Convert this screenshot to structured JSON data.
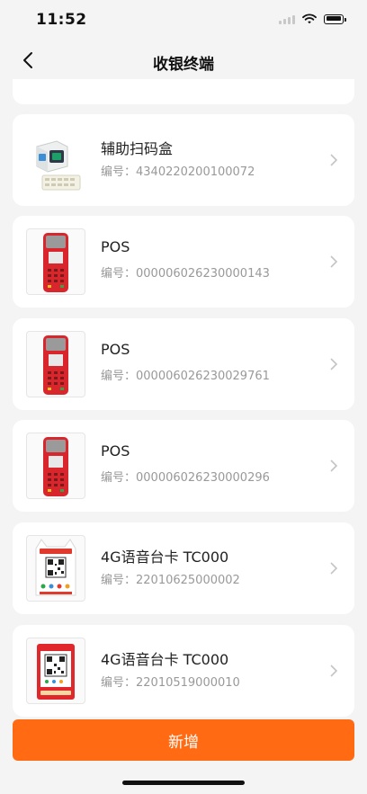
{
  "status_bar": {
    "time": "11:52"
  },
  "nav": {
    "title": "收银终端",
    "back_icon": "chevron-left-icon"
  },
  "device_list": [
    {
      "name": "",
      "sn_label": "",
      "sn": "",
      "image": "scanner-box-icon"
    },
    {
      "name": "辅助扫码盒",
      "sn_label": "编号：",
      "sn": "4340220200100072",
      "image": "scanner-box-icon"
    },
    {
      "name": "POS",
      "sn_label": "编号：",
      "sn": "000006026230000143",
      "image": "pos-terminal-icon"
    },
    {
      "name": "POS",
      "sn_label": "编号：",
      "sn": "000006026230029761",
      "image": "pos-terminal-icon"
    },
    {
      "name": "POS",
      "sn_label": "编号：",
      "sn": "000006026230000296",
      "image": "pos-terminal-icon"
    },
    {
      "name": "4G语音台卡 TC000",
      "sn_label": "编号：",
      "sn": "22010625000002",
      "image": "qr-standee-cat-icon"
    },
    {
      "name": "4G语音台卡 TC000",
      "sn_label": "编号：",
      "sn": "22010519000010",
      "image": "qr-standee-red-icon"
    }
  ],
  "footer": {
    "add_label": "新增"
  },
  "colors": {
    "accent": "#ff6a12",
    "background": "#f4f4f4",
    "card": "#ffffff"
  }
}
